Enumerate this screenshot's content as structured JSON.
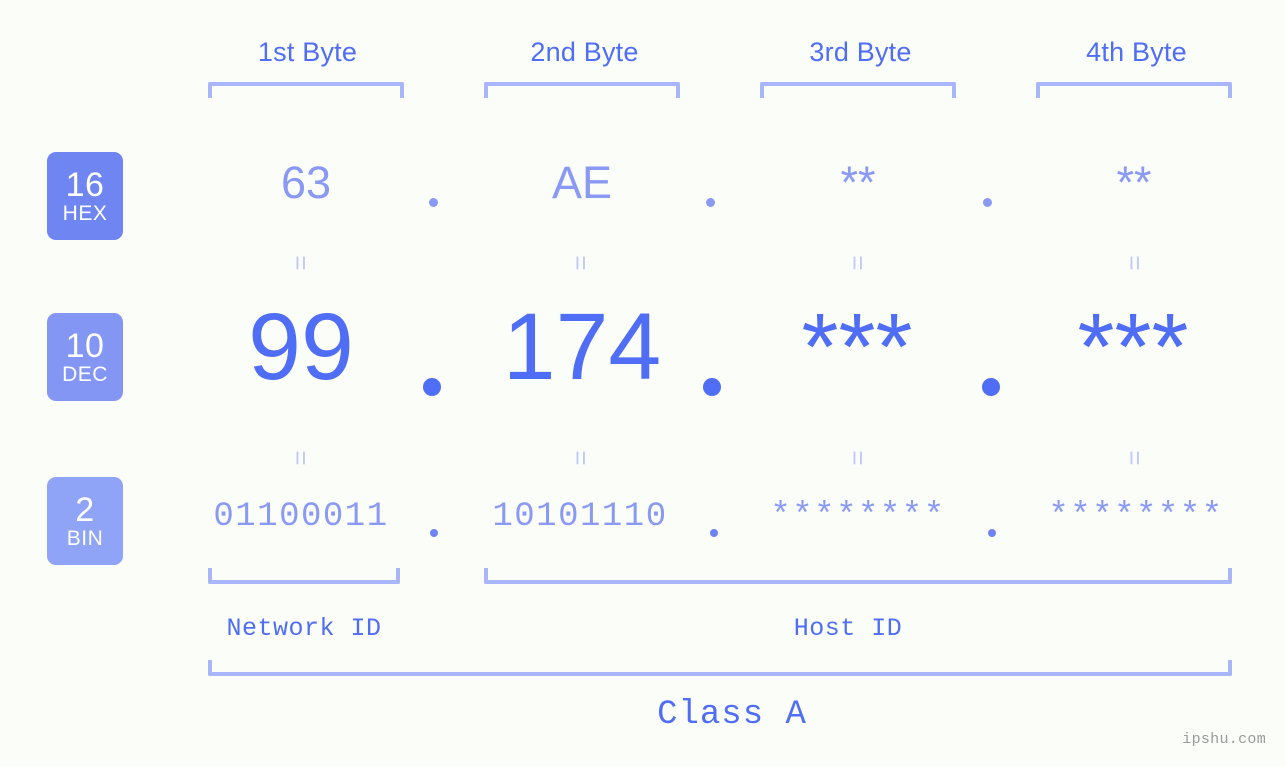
{
  "page": {
    "background": "#fbfdf9",
    "accent": "#4f6df5",
    "accent_light": "#8a99f4",
    "bracket_color": "#aab6fb",
    "watermark": "ipshu.com"
  },
  "columns": [
    {
      "label": "1st Byte"
    },
    {
      "label": "2nd Byte"
    },
    {
      "label": "3rd Byte"
    },
    {
      "label": "4th Byte"
    }
  ],
  "bases": [
    {
      "number": "16",
      "name": "HEX",
      "color": "#6f86f2"
    },
    {
      "number": "10",
      "name": "DEC",
      "color": "#8396f3"
    },
    {
      "number": "2",
      "name": "BIN",
      "color": "#8fa4f6"
    }
  ],
  "rows": {
    "hex": {
      "values": [
        "63",
        "AE",
        "**",
        "**"
      ],
      "separator": "."
    },
    "dec": {
      "values": [
        "99",
        "174",
        "***",
        "***"
      ],
      "separator": "."
    },
    "bin": {
      "values": [
        "01100011",
        "10101110",
        "********",
        "********"
      ],
      "separator": "."
    }
  },
  "equals_symbol": "=",
  "segments": {
    "network_id": "Network ID",
    "host_id": "Host ID",
    "class": "Class A"
  }
}
